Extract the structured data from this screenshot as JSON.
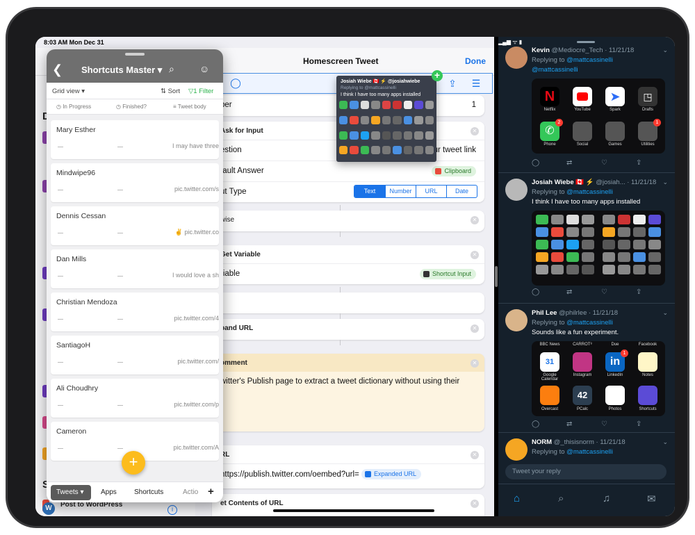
{
  "status": {
    "time": "8:03 AM  Mon Dec 31"
  },
  "shortcuts": {
    "title": "Homescreen Tweet",
    "done": "Done",
    "number_label": "ber",
    "number_value": "1",
    "ask_header": "Ask for Input",
    "question_label": "estion",
    "question_value": "ur tweet link",
    "default_label": "fault Answer",
    "default_value": "Clipboard",
    "input_type_label": "ut Type",
    "segments": [
      "Text",
      "Number",
      "URL",
      "Date"
    ],
    "otherwise": "wise",
    "get_variable_header": "Get Variable",
    "variable_label": "riable",
    "variable_value": "Shortcut Input",
    "expand_url": "pand URL",
    "comment_header": "omment",
    "comment_text": "witter's Publish page to extract a tweet dictionary without using their",
    "url_header": "RL",
    "url_value": "https://publish.twitter.com/oembed?url=",
    "url_token": "Expanded URL",
    "contents_header": "et Contents of URL",
    "bg_letters": [
      "D",
      "S"
    ],
    "bg_behind_title": "Post to WordPress",
    "bg_behind_sub": "Posts the input to a WordPress bl..."
  },
  "drag_preview": {
    "name": "Josiah Wiebe 🇨🇦 ⚡ @josiahwiebe",
    "replying": "Replying to @mattcassinelli",
    "text": "I think I have too many apps installed"
  },
  "airtable": {
    "title": "Shortcuts Master ▾",
    "grid_view": "Grid view ▾",
    "sort": "⇅ Sort",
    "filter": "▽1 Filter",
    "columns": [
      "◷ In Progress",
      "◷ Finished?",
      "≡ Tweet body"
    ],
    "records": [
      {
        "name": "Mary Esther",
        "body": "I may have three"
      },
      {
        "name": "Mindwipe96",
        "body": "pic.twitter.com/s"
      },
      {
        "name": "Dennis Cessan",
        "body": "✌ pic.twitter.co"
      },
      {
        "name": "Dan Mills",
        "body": "I would love a sh"
      },
      {
        "name": "Christian Mendoza",
        "body": "pic.twitter.com/4"
      },
      {
        "name": "SantiagoH",
        "body": "pic.twitter.com/"
      },
      {
        "name": "Ali Choudhry",
        "body": "pic.twitter.com/p"
      },
      {
        "name": "Cameron",
        "body": "pic.twitter.com/A"
      }
    ],
    "tabs": [
      "Tweets ▾",
      "Apps",
      "Shortcuts",
      "Actio",
      "+"
    ]
  },
  "twitter": {
    "tweets": [
      {
        "name": "Kevin",
        "handle": "@Mediocre_Tech · 11/21/18",
        "replying_to": "@mattcassinelli",
        "extra_link": "@mattcassinelli",
        "apps": [
          "Netflix",
          "YouTube",
          "Spark",
          "Drafts",
          "Phone",
          "Social",
          "Games",
          "Utilities"
        ]
      },
      {
        "name": "Josiah Wiebe 🇨🇦 ⚡",
        "handle": "@josiah... · 11/21/18",
        "replying_to": "@mattcassinelli",
        "text": "I think I have too many apps installed"
      },
      {
        "name": "Phil Lee",
        "handle": "@philrlee · 11/21/18",
        "replying_to": "@mattcassinelli",
        "text": "Sounds like a fun experiment.",
        "top_labels": [
          "BBC News",
          "CARROT⁸",
          "Due",
          "Facebook"
        ],
        "apps": [
          "Google Calendar",
          "Instagram",
          "LinkedIn",
          "Notes",
          "Overcast",
          "PCalc",
          "Photos",
          "Shortcuts"
        ]
      },
      {
        "name": "NORM",
        "handle": "@_thisisnorm · 11/21/18",
        "replying_to": "@mattcassinelli"
      }
    ],
    "reply_placeholder": "Tweet your reply",
    "badges": {
      "phone": "2",
      "utilities": "1",
      "linkedin": "1"
    }
  }
}
